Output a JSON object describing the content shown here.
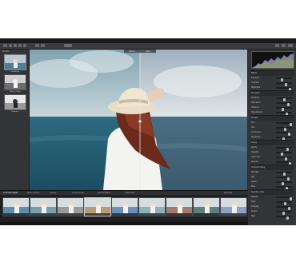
{
  "left_panel": {
    "title": "Presets",
    "presets": [
      "Landscape",
      "Black & White",
      "Negative"
    ]
  },
  "viewer": {
    "before_label": "Before",
    "after_label": "After"
  },
  "right_panel": {
    "sections": [
      "Effects",
      "Film grain",
      "Fill light",
      "Toning",
      "Channel mixing",
      "Selective Color"
    ],
    "rows": [
      "Exposure",
      "Contrast",
      "Highlights",
      "Shadows",
      "Saturation",
      "Vibrance",
      "Temperature",
      "Tint",
      "Hue",
      "Luminance",
      "Sharpness",
      "Clarity",
      "Vignette",
      "Grain size",
      "Amount",
      "Strength",
      "Red",
      "Green",
      "Blue",
      "Opacity",
      "Style",
      "Intensity",
      "Radius",
      "Fade"
    ]
  },
  "filmstrip": {
    "tabs": [
      "Color Film Styles",
      "Black & White",
      "Vintage",
      "Cross Process",
      "Special Effects",
      "Instant Film",
      "Favorites"
    ],
    "thumbs": [
      "",
      "",
      "",
      "",
      "",
      "",
      "",
      "",
      ""
    ]
  },
  "colors": {
    "accent": "#6b8fb8",
    "panel": "#333437",
    "viewer_bg": "#1b1c1e"
  }
}
